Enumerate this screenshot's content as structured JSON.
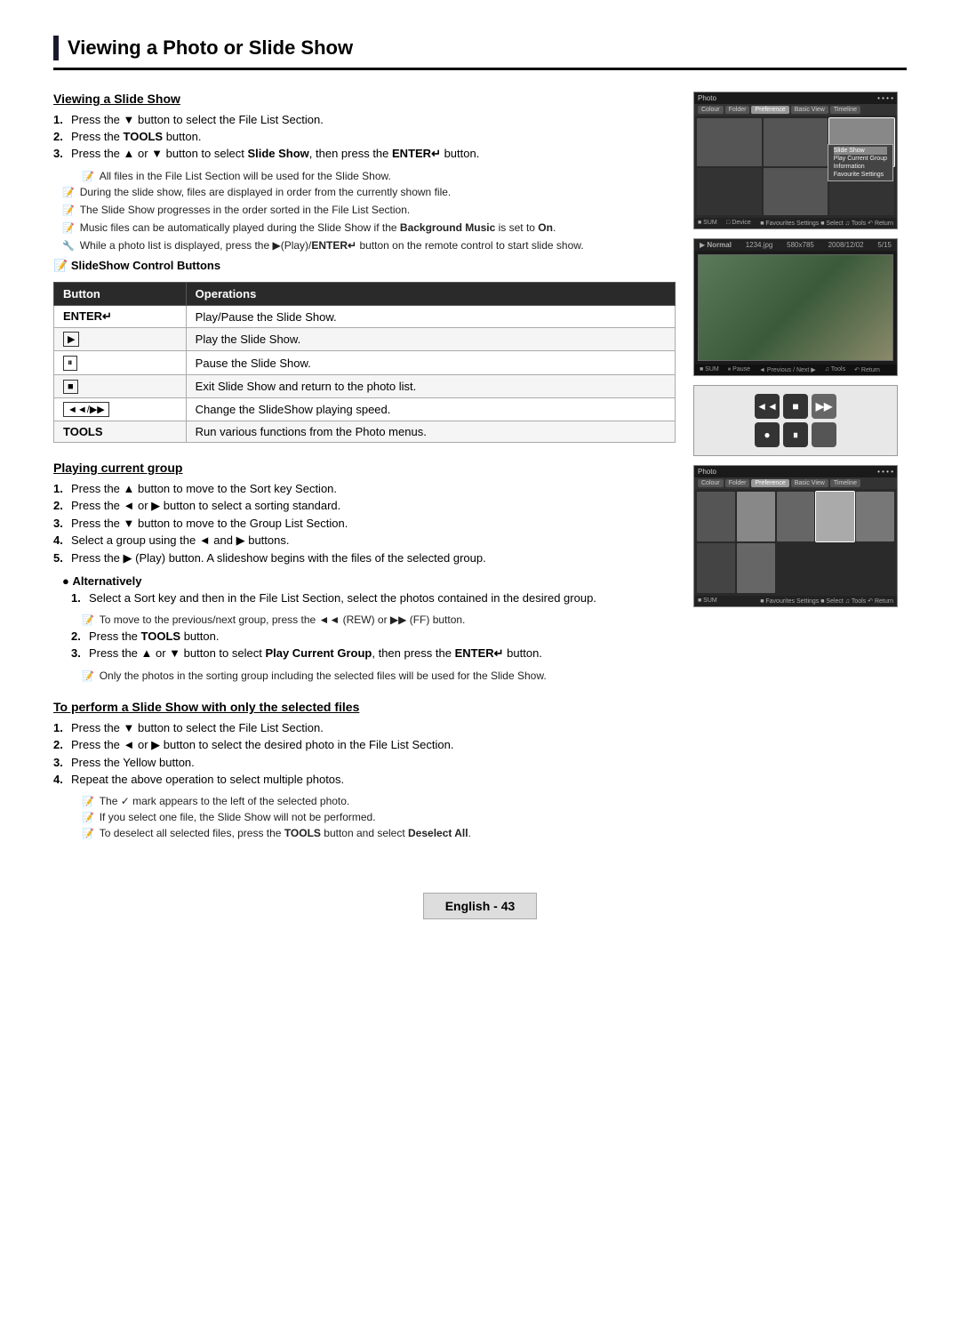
{
  "page": {
    "title": "Viewing a Photo or Slide Show",
    "title_bar_color": "#1a1a2e"
  },
  "sections": {
    "viewing_slide_show": {
      "heading": "Viewing a Slide Show",
      "steps": [
        "Press the ▼ button to select the File List Section.",
        "Press the TOOLS button.",
        "Press the ▲ or ▼ button to select Slide Show, then press the ENTER↵ button."
      ],
      "step3_sub_note": "All files in the File List Section will be used for the Slide Show.",
      "notes": [
        "During the slide show, files are displayed in order from the currently shown file.",
        "The Slide Show progresses in the order sorted in the File List Section.",
        "Music files can be automatically played during the Slide Show if the Background Music is set to On."
      ],
      "note5": "While a photo list is displayed, press the ▶(Play)/ENTER↵ button on the remote control to start slide show.",
      "slideshow_control_buttons": "SlideShow Control Buttons",
      "table": {
        "col1": "Button",
        "col2": "Operations",
        "rows": [
          {
            "button": "ENTER↵",
            "operation": "Play/Pause the Slide Show."
          },
          {
            "button": "▶",
            "operation": "Play the Slide Show."
          },
          {
            "button": "⏸",
            "operation": "Pause the Slide Show."
          },
          {
            "button": "■",
            "operation": "Exit Slide Show and return to the photo list."
          },
          {
            "button": "◄◄/▶▶",
            "operation": "Change the SlideShow playing speed."
          },
          {
            "button": "TOOLS",
            "operation": "Run various functions from the Photo menus."
          }
        ]
      }
    },
    "playing_current_group": {
      "heading": "Playing current group",
      "steps": [
        "Press the ▲ button to move to the Sort key Section.",
        "Press the ◄ or ▶ button to select a sorting standard.",
        "Press the ▼ button to move to the Group List Section.",
        "Select a group using the ◄ and ▶ buttons.",
        "Press the ▶ (Play) button. A slideshow begins with the files of the selected group."
      ],
      "alternatively_label": "Alternatively",
      "alt_steps": [
        "Select a Sort key and then in the File List Section, select the photos contained in the desired group.",
        "Press the TOOLS button.",
        "Press the ▲ or ▼ button to select Play Current Group, then press the ENTER↵ button."
      ],
      "alt_note1": "To move to the previous/next group, press the ◄◄ (REW) or ▶▶ (FF) button.",
      "alt_note2": "Only the photos in the sorting group including the selected files will be used for the Slide Show."
    },
    "selected_files": {
      "heading": "To perform a Slide Show with only the selected files",
      "steps": [
        "Press the ▼ button to select the File List Section.",
        "Press the ◄ or ▶ button to select the desired photo in the File List Section.",
        "Press the Yellow button.",
        "Repeat the above operation to select multiple photos."
      ],
      "notes": [
        "The ✓ mark appears to the left of the selected photo.",
        "If you select one file, the Slide Show will not be performed.",
        "To deselect all selected files, press the TOOLS button and select Deselect All."
      ]
    }
  },
  "footer": {
    "label": "English - 43"
  },
  "screenshots": {
    "ss1_header_left": "Photo",
    "ss1_tabs": [
      "Colour",
      "Folder",
      "Preference",
      "Basic View",
      "Timeline"
    ],
    "ss1_menu_items": [
      "Slide Show",
      "Play Current Group",
      "Information",
      "Favourite Settings"
    ],
    "ss2_header": "Normal",
    "ss2_filename": "1234.jpg",
    "ss2_resolution": "580x785",
    "ss2_date": "2008/12/02",
    "ss2_count": "5/15"
  }
}
